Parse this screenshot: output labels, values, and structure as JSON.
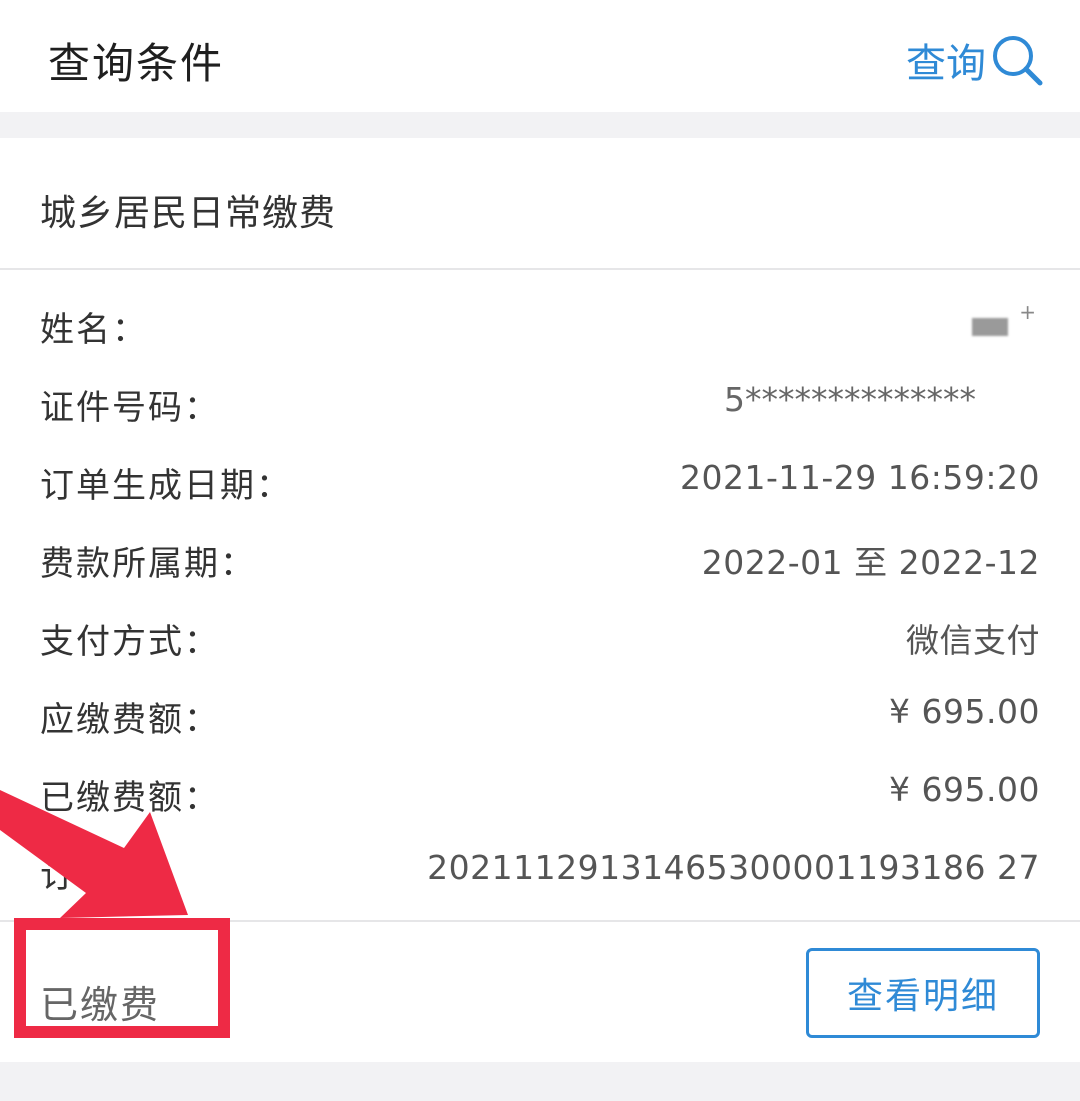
{
  "header": {
    "title": "查询条件",
    "query_label": "查询",
    "query_icon": "search-icon"
  },
  "card": {
    "title": "城乡居民日常缴费",
    "rows": [
      {
        "label": "姓名：",
        "value": "■"
      },
      {
        "label": "证件号码：",
        "value": "5**************"
      },
      {
        "label": "订单生成日期：",
        "value": "2021-11-29 16:59:20"
      },
      {
        "label": "费款所属期：",
        "value": "2022-01 至 2022-12"
      },
      {
        "label": "支付方式：",
        "value": "微信支付"
      },
      {
        "label": "应缴费额：",
        "value": "¥ 695.00"
      },
      {
        "label": "已缴费额：",
        "value": "¥ 695.00"
      },
      {
        "label": "订单号：",
        "value": "20211129131465300001193186 27"
      }
    ],
    "status": "已缴费",
    "detail_button": "查看明细"
  },
  "colors": {
    "accent": "#2f8ad6",
    "highlight": "#ee2a45",
    "background": "#f2f2f4"
  }
}
